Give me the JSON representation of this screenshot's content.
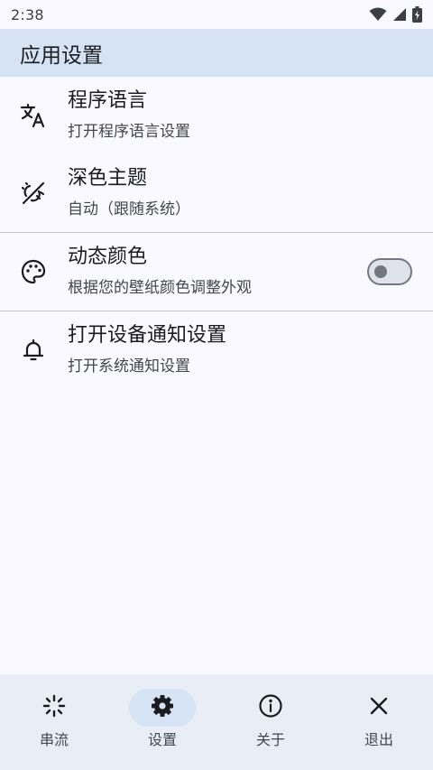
{
  "status_bar": {
    "time": "2:38",
    "icons": [
      "wifi-icon",
      "cell-signal-icon",
      "battery-charging-icon"
    ]
  },
  "app_bar": {
    "title": "应用设置"
  },
  "settings": [
    {
      "icon": "translate-icon",
      "title": "程序语言",
      "subtitle": "打开程序语言设置"
    },
    {
      "icon": "dark-mode-icon",
      "title": "深色主题",
      "subtitle": "自动（跟随系统）"
    },
    {
      "icon": "palette-icon",
      "title": "动态颜色",
      "subtitle": "根据您的壁纸颜色调整外观",
      "toggle_on": false
    },
    {
      "icon": "bell-icon",
      "title": "打开设备通知设置",
      "subtitle": "打开系统通知设置"
    }
  ],
  "bottom_nav": {
    "items": [
      {
        "icon": "stream-icon",
        "label": "串流",
        "active": false
      },
      {
        "icon": "gear-icon",
        "label": "设置",
        "active": true
      },
      {
        "icon": "info-icon",
        "label": "关于",
        "active": false
      },
      {
        "icon": "close-icon",
        "label": "退出",
        "active": false
      }
    ]
  },
  "colors": {
    "background": "#f9f9ff",
    "app_bar": "#d5e3f5",
    "nav_bar": "#e9eef6",
    "active_indicator": "#d5e3f5",
    "divider": "#c3c6cf"
  }
}
